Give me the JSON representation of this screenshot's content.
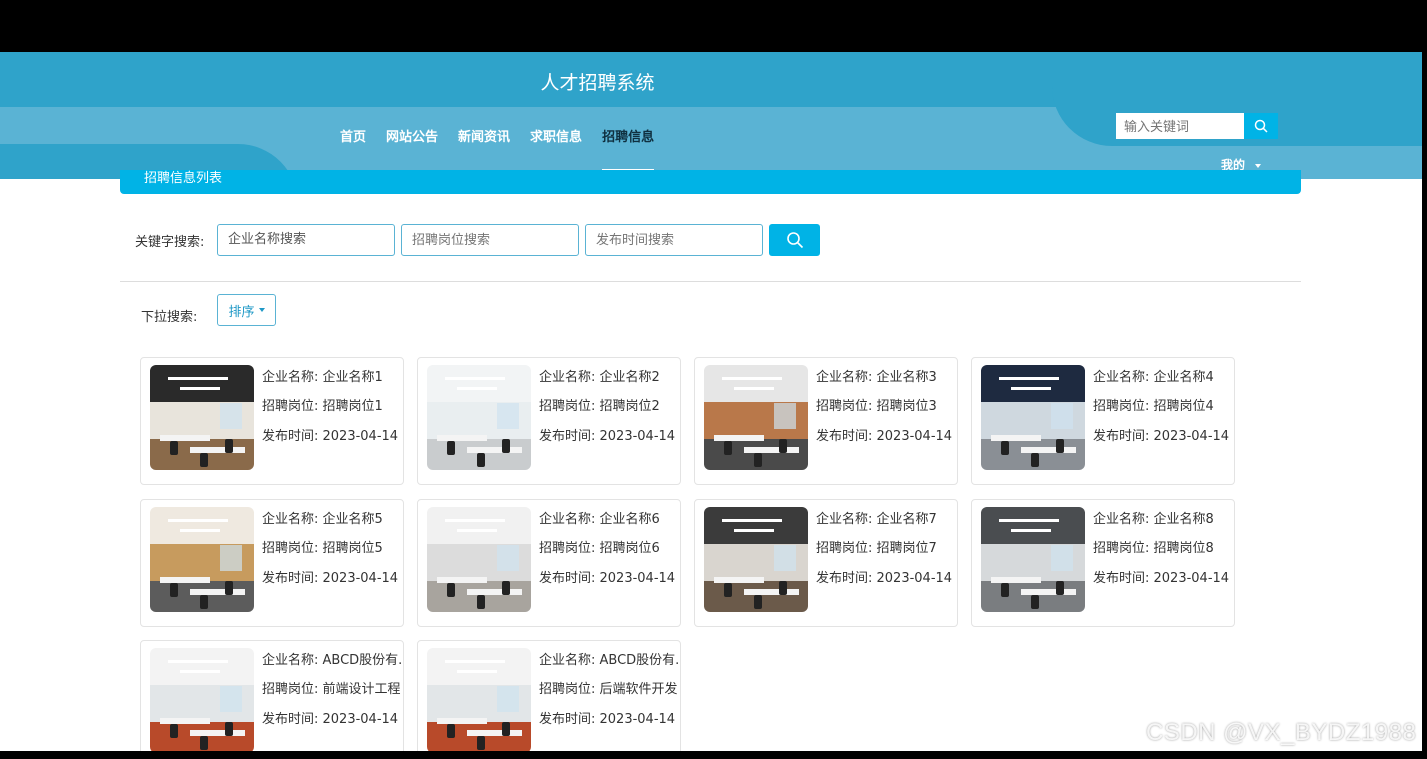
{
  "header": {
    "title": "人才招聘系统",
    "nav": [
      "首页",
      "网站公告",
      "新闻资讯",
      "求职信息",
      "招聘信息"
    ],
    "active_nav": "招聘信息",
    "search_placeholder": "输入关键词",
    "mine_label": "我的"
  },
  "section_title": "招聘信息列表",
  "filters": {
    "keyword_label": "关键字搜索:",
    "company_value": "企业名称搜索",
    "position_placeholder": "招聘岗位搜索",
    "date_placeholder": "发布时间搜索",
    "dropdown_label": "下拉搜索:",
    "sort_label": "排序"
  },
  "cards": [
    {
      "company": "企业名称: 企业名称1",
      "position": "招聘岗位: 招聘岗位1",
      "date": "发布时间: 2023-04-14"
    },
    {
      "company": "企业名称: 企业名称2",
      "position": "招聘岗位: 招聘岗位2",
      "date": "发布时间: 2023-04-14"
    },
    {
      "company": "企业名称: 企业名称3",
      "position": "招聘岗位: 招聘岗位3",
      "date": "发布时间: 2023-04-14"
    },
    {
      "company": "企业名称: 企业名称4",
      "position": "招聘岗位: 招聘岗位4",
      "date": "发布时间: 2023-04-14"
    },
    {
      "company": "企业名称: 企业名称5",
      "position": "招聘岗位: 招聘岗位5",
      "date": "发布时间: 2023-04-14"
    },
    {
      "company": "企业名称: 企业名称6",
      "position": "招聘岗位: 招聘岗位6",
      "date": "发布时间: 2023-04-14"
    },
    {
      "company": "企业名称: 企业名称7",
      "position": "招聘岗位: 招聘岗位7",
      "date": "发布时间: 2023-04-14"
    },
    {
      "company": "企业名称: 企业名称8",
      "position": "招聘岗位: 招聘岗位8",
      "date": "发布时间: 2023-04-14"
    },
    {
      "company": "企业名称: ABCD股份有.",
      "position": "招聘岗位: 前端设计工程",
      "date": "发布时间: 2023-04-14"
    },
    {
      "company": "企业名称: ABCD股份有.",
      "position": "招聘岗位: 后端软件开发",
      "date": "发布时间: 2023-04-14"
    }
  ],
  "watermark": "CSDN @VX_BYDZ1988",
  "colors": {
    "primary": "#00b3e6",
    "header_dark": "#2fa3ca",
    "header_light": "#5ab3d4"
  },
  "icons": {
    "search": "search-icon",
    "caret": "caret-down-icon"
  }
}
